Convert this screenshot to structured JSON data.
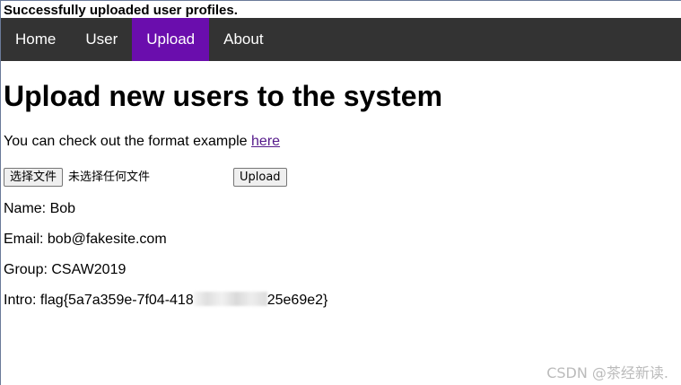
{
  "status_message": "Successfully uploaded user profiles.",
  "nav": {
    "items": [
      {
        "label": "Home",
        "active": false
      },
      {
        "label": "User",
        "active": false
      },
      {
        "label": "Upload",
        "active": true
      },
      {
        "label": "About",
        "active": false
      }
    ],
    "background": "#333333",
    "active_color": "#6a0dad"
  },
  "page": {
    "heading": "Upload new users to the system",
    "format_text": "You can check out the format example ",
    "format_link": "here"
  },
  "upload_form": {
    "choose_button_label": "选择文件",
    "file_status": "未选择任何文件",
    "upload_button_label": "Upload"
  },
  "profile": {
    "name": "Name: Bob",
    "email": "Email: bob@fakesite.com",
    "group": "Group: CSAW2019",
    "intro_prefix": "Intro: flag{5a7a359e-7f04-418",
    "intro_suffix": "25e69e2}"
  },
  "watermark": "CSDN @茶经新读."
}
